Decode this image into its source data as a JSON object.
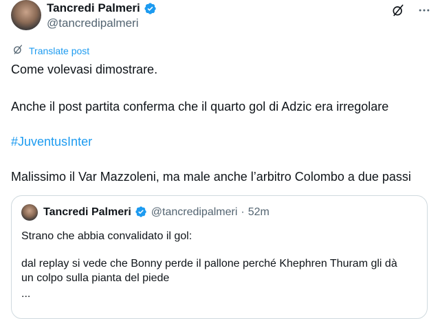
{
  "author": {
    "name": "Tancredi Palmeri",
    "handle": "@tancredipalmeri"
  },
  "translate_label": "Translate post",
  "post": {
    "line1": "Come volevasi dimostrare.",
    "line2": "Anche il post partita conferma che il quarto gol di Adzic era irregolare",
    "hashtag": "#JuventusInter",
    "line3": "Malissimo il Var Mazzoleni, ma male anche l’arbitro Colombo a due passi"
  },
  "quoted": {
    "name": "Tancredi Palmeri",
    "handle": "@tancredipalmeri",
    "separator": "·",
    "time": "52m",
    "line1": "Strano che abbia convalidato il gol:",
    "line2": "dal replay si vede che Bonny perde il pallone perché Khephren Thuram gli dà",
    "line3": "un colpo sulla pianta del piede",
    "ellipsis": "..."
  },
  "icons": {
    "verified": "verified-badge-icon",
    "grok": "grok-icon",
    "more": "more-icon",
    "translate": "translate-icon"
  },
  "colors": {
    "accent": "#1d9bf0",
    "text": "#0f1419",
    "secondary": "#536471",
    "border": "#cfd9de"
  }
}
